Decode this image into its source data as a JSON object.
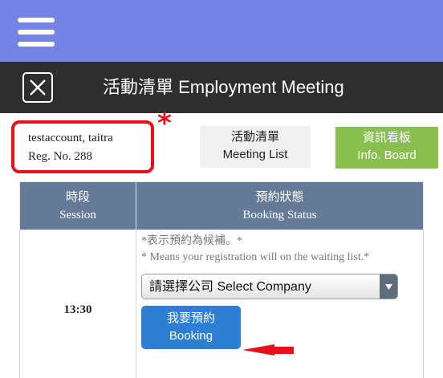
{
  "header": {
    "menu_icon": "hamburger-menu-icon",
    "close_icon": "close-icon",
    "title": "活動清單 Employment Meeting"
  },
  "account": {
    "name": "testaccount, taitra",
    "reg_no": "Reg. No. 288",
    "marker": "*"
  },
  "buttons": {
    "meeting_list_zh": "活動清單",
    "meeting_list_en": "Meeting List",
    "info_board_zh": "資訊看板",
    "info_board_en": "Info. Board"
  },
  "table": {
    "headers": [
      {
        "zh": "時段",
        "en": "Session"
      },
      {
        "zh": "預約狀態",
        "en": "Booking Status"
      }
    ],
    "rows": [
      {
        "session": "13:30",
        "note_zh": "*表示預約為候補。*",
        "note_en": "* Means your registration will on the waiting list.*",
        "select_value": "請選擇公司 Select Company",
        "booking_zh": "我要預約",
        "booking_en": "Booking"
      }
    ]
  },
  "colors": {
    "top_bar": "#7484e4",
    "title_bar": "#2e2e2e",
    "highlight_red": "#e8101a",
    "info_board_green": "#89bf4f",
    "table_header": "#657a96",
    "booking_blue": "#2e7fd3"
  }
}
